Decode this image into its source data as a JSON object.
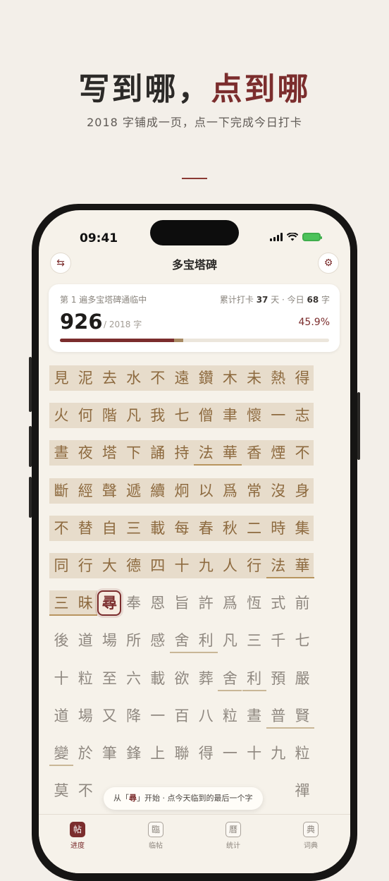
{
  "hero": {
    "title_main": "写到哪，",
    "title_accent": "点到哪",
    "subtitle": "2018 字铺成一页，点一下完成今日打卡"
  },
  "status_bar": {
    "time": "09:41"
  },
  "nav": {
    "title": "多宝塔碑",
    "left_icon": "swap-icon",
    "right_icon": "gear-icon"
  },
  "progress_card": {
    "pass_label": "第 1 遍多宝塔碑通临中",
    "streak_prefix": "累计打卡 ",
    "streak_days": "37",
    "streak_mid": " 天 · 今日 ",
    "today_count": "68",
    "streak_suffix": " 字",
    "count": "926",
    "total": "/ 2018 字",
    "percent": "45.9%",
    "progress_fraction": 0.459,
    "today_fraction": 0.0337
  },
  "grid": {
    "rows": [
      {
        "highlight": true,
        "chars": [
          "見",
          "泥",
          "去",
          "水",
          "不",
          "遠",
          "鑽",
          "木",
          "未",
          "熱",
          "得"
        ]
      },
      {
        "highlight": true,
        "chars": [
          "火",
          "何",
          "階",
          "凡",
          "我",
          "七",
          "僧",
          "聿",
          "懷",
          "一",
          "志"
        ]
      },
      {
        "highlight": true,
        "chars": [
          "晝",
          "夜",
          "塔",
          "下",
          "誦",
          "持",
          "法",
          "華",
          "香",
          "煙",
          "不"
        ]
      },
      {
        "highlight": true,
        "chars": [
          "斷",
          "經",
          "聲",
          "遞",
          "續",
          "炯",
          "以",
          "爲",
          "常",
          "沒",
          "身"
        ]
      },
      {
        "highlight": true,
        "chars": [
          "不",
          "替",
          "自",
          "三",
          "載",
          "每",
          "春",
          "秋",
          "二",
          "時",
          "集"
        ]
      },
      {
        "highlight": true,
        "chars": [
          "同",
          "行",
          "大",
          "德",
          "四",
          "十",
          "九",
          "人",
          "行",
          "法",
          "華"
        ]
      },
      {
        "highlight": "partial",
        "chars": [
          "三",
          "昧",
          "尋",
          "奉",
          "恩",
          "旨",
          "許",
          "爲",
          "恆",
          "式",
          "前"
        ]
      },
      {
        "highlight": false,
        "chars": [
          "後",
          "道",
          "場",
          "所",
          "感",
          "舍",
          "利",
          "凡",
          "三",
          "千",
          "七"
        ]
      },
      {
        "highlight": false,
        "chars": [
          "十",
          "粒",
          "至",
          "六",
          "載",
          "欲",
          "葬",
          "舍",
          "利",
          "預",
          "嚴"
        ]
      },
      {
        "highlight": false,
        "chars": [
          "道",
          "場",
          "又",
          "降",
          "一",
          "百",
          "八",
          "粒",
          "晝",
          "普",
          "賢"
        ]
      },
      {
        "highlight": false,
        "chars": [
          "變",
          "於",
          "筆",
          "鋒",
          "上",
          "聯",
          "得",
          "一",
          "十",
          "九",
          "粒"
        ]
      },
      {
        "highlight": false,
        "chars": [
          "莫",
          "不",
          "",
          "",
          "",
          "",
          "",
          "",
          "",
          "",
          "禪"
        ]
      }
    ],
    "underlined": [
      "2-6",
      "2-7",
      "5-9",
      "5-10",
      "6-0",
      "6-1",
      "7-5",
      "7-6",
      "8-7",
      "8-8",
      "9-9",
      "9-10",
      "10-0"
    ],
    "current": "6-2"
  },
  "toast": {
    "prefix": "从「",
    "char": "尋",
    "suffix": "」开始 · 点今天临到的最后一个字"
  },
  "tabs": [
    {
      "icon_char": "帖",
      "label": "进度",
      "active": true
    },
    {
      "icon_char": "臨",
      "label": "临帖",
      "active": false
    },
    {
      "icon_char": "曆",
      "label": "统计",
      "active": false
    },
    {
      "icon_char": "典",
      "label": "词典",
      "active": false
    }
  ],
  "colors": {
    "accent": "#7b2d2d",
    "done_text": "#8d6a3f",
    "done_bg": "#e7dccb",
    "pending_text": "#8f8880",
    "background": "#f3efe9"
  }
}
